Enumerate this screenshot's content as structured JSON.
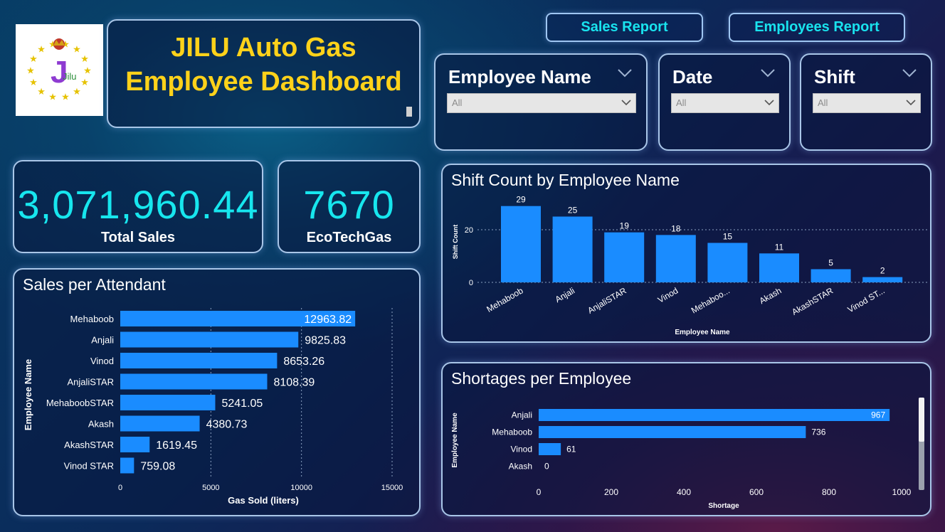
{
  "header": {
    "title_line1": "JILU Auto Gas",
    "title_line2": "Employee Dashboard",
    "logo_text": "Jilu"
  },
  "nav": {
    "sales_report": "Sales Report",
    "employees_report": "Employees Report"
  },
  "filters": {
    "employee_name": {
      "label": "Employee Name",
      "value": "All"
    },
    "date": {
      "label": "Date",
      "value": "All"
    },
    "shift": {
      "label": "Shift",
      "value": "All"
    }
  },
  "kpis": {
    "total_sales": {
      "value": "3,071,960.44",
      "label": "Total Sales"
    },
    "ecotechgas": {
      "value": "7670",
      "label": "EcoTechGas"
    }
  },
  "colors": {
    "bar": "#1a8cff",
    "kpi": "#17e6ee",
    "title": "#ffd21a",
    "nav": "#19e3ee"
  },
  "chart_data": [
    {
      "id": "sales",
      "type": "bar",
      "orientation": "horizontal",
      "title": "Sales per Attendant",
      "xlabel": "Gas Sold (liters)",
      "ylabel": "Employee Name",
      "categories": [
        "Mehaboob",
        "Anjali",
        "Vinod",
        "AnjaliSTAR",
        "MehaboobSTAR",
        "Akash",
        "AkashSTAR",
        "Vinod STAR"
      ],
      "values": [
        12963.82,
        9825.83,
        8653.26,
        8108.39,
        5241.05,
        4380.73,
        1619.45,
        759.08
      ],
      "labels": [
        "12963.82",
        "9825.83",
        "8653.26",
        "8108.39",
        "5241.05",
        "4380.73",
        "1619.45",
        "759.08"
      ],
      "xlim": [
        0,
        15000
      ],
      "xticks": [
        0,
        5000,
        10000,
        15000
      ],
      "grid": true
    },
    {
      "id": "shift",
      "type": "bar",
      "orientation": "vertical",
      "title": "Shift Count by Employee Name",
      "xlabel": "Employee Name",
      "ylabel": "Shift Count",
      "categories": [
        "Mehaboob",
        "Anjali",
        "AnjaliSTAR",
        "Vinod",
        "Mehaboo...",
        "Akash",
        "AkashSTAR",
        "Vinod ST..."
      ],
      "values": [
        29,
        25,
        19,
        18,
        15,
        11,
        5,
        2
      ],
      "ylim": [
        0,
        30
      ],
      "yticks": [
        0,
        20
      ],
      "grid": true
    },
    {
      "id": "short",
      "type": "bar",
      "orientation": "horizontal",
      "title": "Shortages per Employee",
      "xlabel": "Shortage",
      "ylabel": "Employee Name",
      "categories": [
        "Anjali",
        "Mehaboob",
        "Vinod",
        "Akash"
      ],
      "values": [
        967,
        736,
        61,
        0
      ],
      "xlim": [
        0,
        1000
      ],
      "xticks": [
        0,
        200,
        400,
        600,
        800,
        1000
      ],
      "grid": false
    }
  ]
}
